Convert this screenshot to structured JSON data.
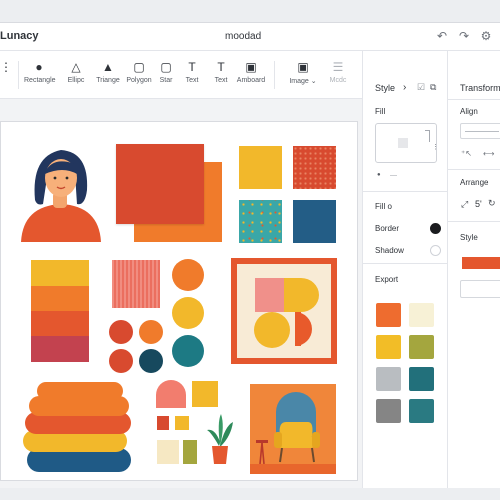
{
  "app": {
    "name": "Lunacy"
  },
  "document": {
    "title": "moodad"
  },
  "titlebar_icons": [
    "undo-icon",
    "redo-icon",
    "settings-icon"
  ],
  "toolbar": {
    "tools": [
      {
        "id": "rectangle",
        "label": "Rectangle",
        "icon": "circle-icon"
      },
      {
        "id": "ellipse",
        "label": "Ellipc",
        "icon": "triangle-outline-icon"
      },
      {
        "id": "triangle",
        "label": "Triange",
        "icon": "triangle-icon"
      },
      {
        "id": "polygon",
        "label": "Polygon",
        "icon": "square-outline-icon"
      },
      {
        "id": "star",
        "label": "Star",
        "icon": "square-outline-icon"
      },
      {
        "id": "text",
        "label": "Text",
        "icon": "text-icon"
      },
      {
        "id": "text2",
        "label": "Text",
        "icon": "text-icon"
      },
      {
        "id": "artboard",
        "label": "Amboard",
        "icon": "image-icon"
      },
      {
        "id": "image",
        "label": "Image",
        "icon": "image-icon"
      },
      {
        "id": "more",
        "label": "Mcdc",
        "icon": "list-icon"
      }
    ]
  },
  "style_panel": {
    "title": "Style",
    "fill_label": "Fill",
    "fill_o_label": "Fill o",
    "border_label": "Border",
    "shadow_label": "Shadow",
    "export_label": "Export",
    "export_colors": [
      "#ee6c2f",
      "#f7f1d6",
      "#f2bd27",
      "#a4a63e",
      "#b9bdc1",
      "#22707b",
      "#858585",
      "#2a7a82"
    ]
  },
  "transform_panel": {
    "title": "Transform",
    "align_label": "Align",
    "arrange_label": "Arrange",
    "arrange_value": "5'",
    "style_label": "Style",
    "style_color": "#e4572e"
  },
  "colors": {
    "accent": "#e4572e",
    "orange": "#f07b2b",
    "red": "#d84a2f",
    "yellow": "#f2b82b",
    "teal": "#1d7a84",
    "navy": "#274f78",
    "pink": "#f0908a"
  }
}
